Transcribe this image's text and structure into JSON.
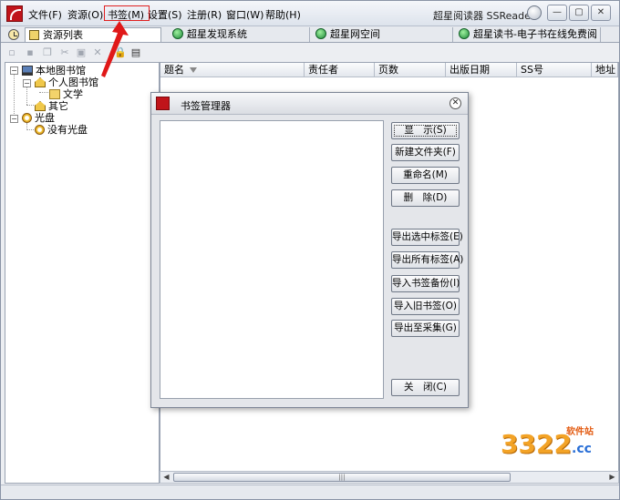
{
  "menubar": {
    "items": [
      {
        "label": "文件(F)"
      },
      {
        "label": "资源(O)"
      },
      {
        "label": "书签(M)"
      },
      {
        "label": "设置(S)"
      },
      {
        "label": "注册(R)"
      },
      {
        "label": "窗口(W)"
      },
      {
        "label": "帮助(H)"
      }
    ],
    "app_title": "超星阅读器 SSReader",
    "highlight_color": "#e02020"
  },
  "tabs": [
    {
      "label": "资源列表"
    },
    {
      "label": "超星发现系统"
    },
    {
      "label": "超星网空间"
    },
    {
      "label": "超星读书-电子书在线免费阅"
    }
  ],
  "tree": [
    {
      "label": "本地图书馆"
    },
    {
      "label": "个人图书馆"
    },
    {
      "label": "文学"
    },
    {
      "label": "其它"
    },
    {
      "label": "光盘"
    },
    {
      "label": "没有光盘"
    }
  ],
  "columns": [
    {
      "label": "题名"
    },
    {
      "label": "责任者"
    },
    {
      "label": "页数"
    },
    {
      "label": "出版日期"
    },
    {
      "label": "SS号"
    },
    {
      "label": "地址"
    }
  ],
  "dialog": {
    "title": "书签管理器",
    "buttons": [
      {
        "label": "显　示(S)"
      },
      {
        "label": "新建文件夹(F)"
      },
      {
        "label": "重命名(M)"
      },
      {
        "label": "删　除(D)"
      },
      {
        "label": "导出选中标签(E)"
      },
      {
        "label": "导出所有标签(A)"
      },
      {
        "label": "导入书签备份(I)"
      },
      {
        "label": "导入旧书签(O)"
      },
      {
        "label": "导出至采集(G)"
      },
      {
        "label": "关　闭(C)"
      }
    ]
  },
  "watermark": {
    "number": "3322",
    "tag": "软件站",
    "domain": ".cc"
  }
}
